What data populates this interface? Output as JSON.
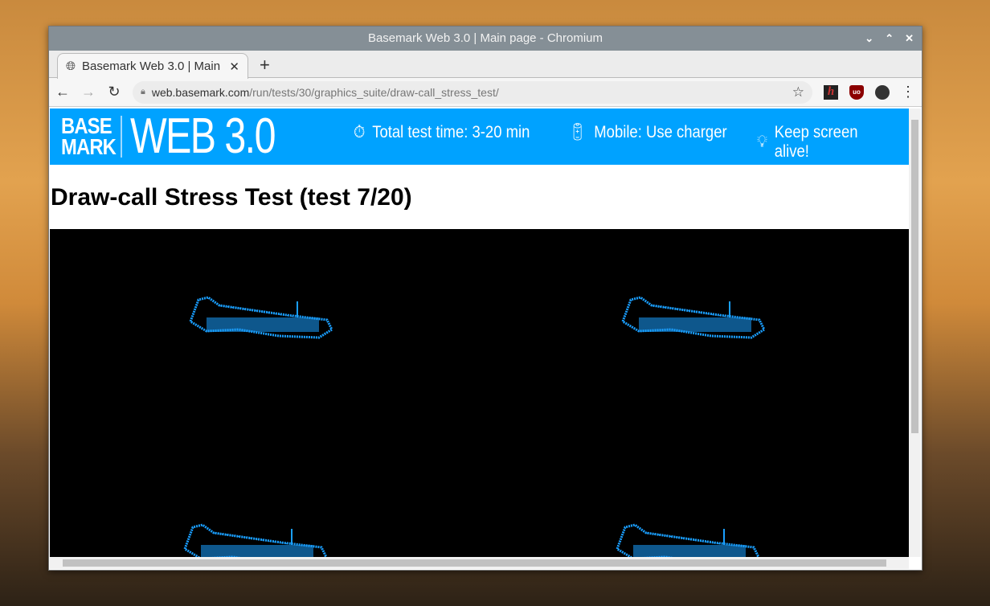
{
  "window": {
    "title": "Basemark Web 3.0 | Main page - Chromium"
  },
  "tab": {
    "label": "Basemark Web 3.0 | Main page"
  },
  "address": {
    "host": "web.basemark.com",
    "path": "/run/tests/30/graphics_suite/draw-call_stress_test/"
  },
  "header": {
    "logo_top": "BASE",
    "logo_bottom": "MARK",
    "logo_product": "WEB 3.0",
    "info": [
      "Total test time: 3-20 min",
      "Mobile: Use charger",
      "Keep screen alive!"
    ]
  },
  "page": {
    "title": "Draw-call Stress Test (test 7/20)"
  },
  "colors": {
    "brand": "#00a2ff",
    "plane": "#1a9fff"
  }
}
